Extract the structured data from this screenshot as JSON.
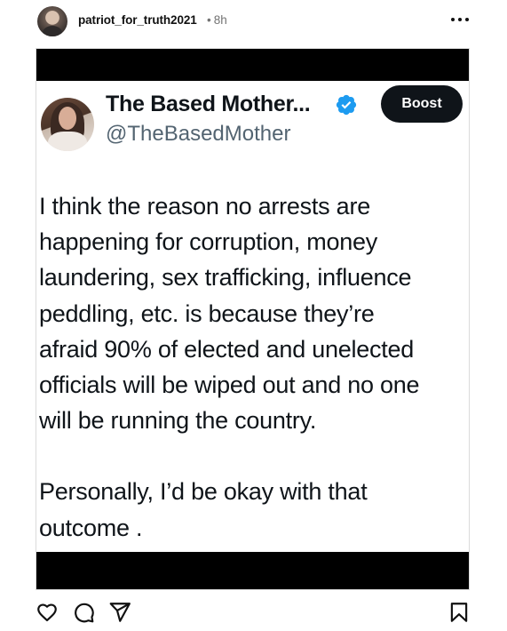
{
  "post": {
    "username": "patriot_for_truth2021",
    "separator": "•",
    "time": "8h",
    "more_icon": "more-horizontal-icon"
  },
  "tweet": {
    "display_name": "The Based Mother...",
    "handle": "@TheBasedMother",
    "verified_icon": "verified-badge-icon",
    "verified_color": "#1d9bf0",
    "boost_label": "Boost",
    "body_lines": [
      "I think the reason no arrests are",
      "happening for corruption, money",
      "laundering, sex trafficking, influence",
      "peddling, etc. is because they’re",
      "afraid 90% of elected and unelected",
      "officials will be wiped out and no one",
      "will be running the country."
    ],
    "body_lines_2": [
      "Personally, I’d be okay with that",
      "outcome ."
    ]
  },
  "actions": {
    "like_icon": "heart-icon",
    "comment_icon": "comment-icon",
    "share_icon": "send-icon",
    "save_icon": "bookmark-icon"
  }
}
